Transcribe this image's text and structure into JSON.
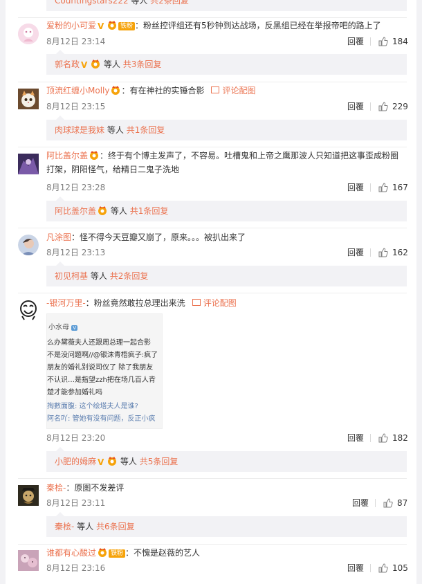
{
  "top_partial": {
    "user": "Countingstars222",
    "suffix": "等人",
    "count": "共2条回复"
  },
  "comments": [
    {
      "user": "爱粉的小可爱",
      "text": "：粉丝控评组还有5秒钟到达战场，反黑组已经在举报帝吧的路上了",
      "fan_label": "铁粉",
      "time": "8月12日 23:14",
      "reply": "回覆",
      "likes": "184",
      "sub": {
        "user": "郭名政",
        "suffix": "等人",
        "count": "共3条回复"
      }
    },
    {
      "user": "顶流红缠小Molly",
      "text": "：有在神社的实锤合影",
      "pic_link": "评论配图",
      "time": "8月12日 23:15",
      "reply": "回覆",
      "likes": "229",
      "sub": {
        "user": "肉球球是我妹",
        "suffix": "等人",
        "count": "共1条回复"
      }
    },
    {
      "user": "阿比盖尔盖",
      "text": "：终于有个博主发声了，不容易。吐槽鬼和上帝之鹰那波人只知道把这事歪成粉圈",
      "text2": "打架，阴阳怪气，给精日二鬼子洗地",
      "time": "8月12日 23:28",
      "reply": "回覆",
      "likes": "167",
      "sub": {
        "user": "阿比盖尔盖",
        "suffix": "等人",
        "count": "共1条回复"
      }
    },
    {
      "user": "凡涂图",
      "text": "：怪不得今天豆瓣又崩了，原来。。。被扒出来了",
      "time": "8月12日 23:13",
      "reply": "回覆",
      "likes": "162",
      "sub": {
        "user": "初见柯基",
        "suffix": "等人",
        "count": "共2条回复"
      }
    },
    {
      "user": "-银河万里-",
      "text": "：粉丝竟然敢拉总理出来洗",
      "pic_link": "评论配图",
      "image_lines": [
        "小水母",
        "么办黛薇夫人还跟周总理一起合影",
        "不是没问题啊//@银沫青梧疯子:疯了",
        "朋友的婚礼别说司仪了 除了我朋友",
        "不认识…是指望zzh把在场几百人背",
        "楚才能参加婚礼吗",
        "掏數面腹: 这个绘塔夫人是谁?",
        "阿名吖: 管她有没有问题，反正小疯"
      ],
      "time": "8月12日 23:20",
      "reply": "回覆",
      "likes": "182",
      "sub": {
        "user": "小肥的姆麻",
        "suffix": "等人",
        "count": "共5条回复"
      }
    },
    {
      "user": "秦桧-",
      "text": "：原图不发差评",
      "time": "8月12日 23:11",
      "reply": "回覆",
      "likes": "87",
      "sub": {
        "user": "秦桧-",
        "suffix": "等人",
        "count": "共6条回复"
      }
    },
    {
      "user": "谁都有心酸过",
      "text": "：不愧是赵薇的艺人",
      "fan_label": "铁粉",
      "time": "8月12日 23:16",
      "reply": "回覆",
      "likes": "105"
    }
  ]
}
